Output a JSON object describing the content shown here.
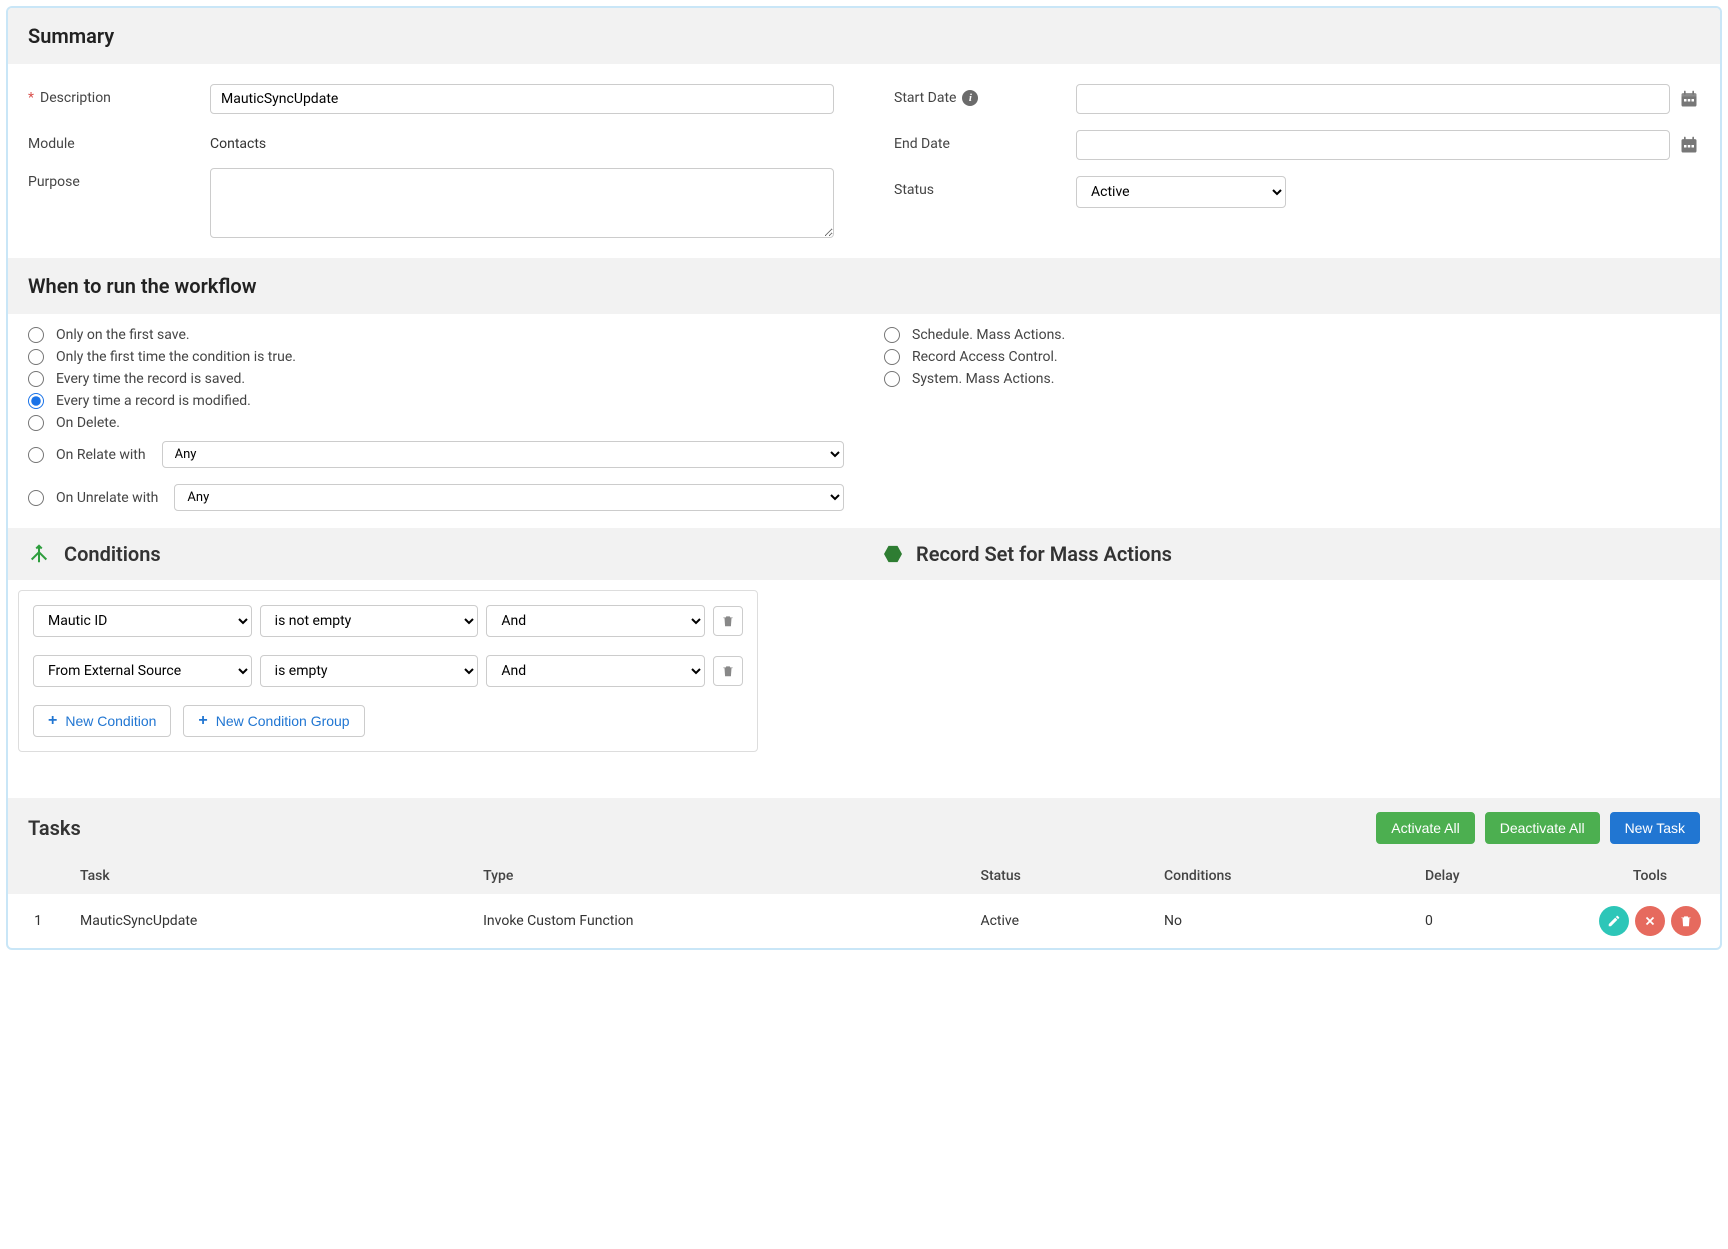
{
  "summary": {
    "title": "Summary",
    "description_label": "Description",
    "description_value": "MauticSyncUpdate",
    "module_label": "Module",
    "module_value": "Contacts",
    "purpose_label": "Purpose",
    "purpose_value": "",
    "start_date_label": "Start Date",
    "start_date_value": "",
    "end_date_label": "End Date",
    "end_date_value": "",
    "status_label": "Status",
    "status_value": "Active"
  },
  "when": {
    "title": "When to run the workflow",
    "opt_first_save": "Only on the first save.",
    "opt_first_cond": "Only the first time the condition is true.",
    "opt_every_save": "Every time the record is saved.",
    "opt_every_modify": "Every time a record is modified.",
    "opt_on_delete": "On Delete.",
    "opt_on_relate": "On Relate with",
    "opt_on_unrelate": "On Unrelate with",
    "opt_schedule": "Schedule. Mass Actions.",
    "opt_rac": "Record Access Control.",
    "opt_system": "System. Mass Actions.",
    "relate_sel": "Any",
    "unrelate_sel": "Any",
    "selected": "every_modify"
  },
  "conditions": {
    "title": "Conditions",
    "recordset_title": "Record Set for Mass Actions",
    "rows": [
      {
        "field": "Mautic ID",
        "op": "is not empty",
        "logic": "And"
      },
      {
        "field": "From External Source",
        "op": "is empty",
        "logic": "And"
      }
    ],
    "new_condition": "New Condition",
    "new_group": "New Condition Group"
  },
  "tasks": {
    "title": "Tasks",
    "activate_all": "Activate All",
    "deactivate_all": "Deactivate All",
    "new_task": "New Task",
    "cols": {
      "task": "Task",
      "type": "Type",
      "status": "Status",
      "conditions": "Conditions",
      "delay": "Delay",
      "tools": "Tools"
    },
    "rows": [
      {
        "num": "1",
        "task": "MauticSyncUpdate",
        "type": "Invoke Custom Function",
        "status": "Active",
        "conditions": "No",
        "delay": "0"
      }
    ]
  }
}
